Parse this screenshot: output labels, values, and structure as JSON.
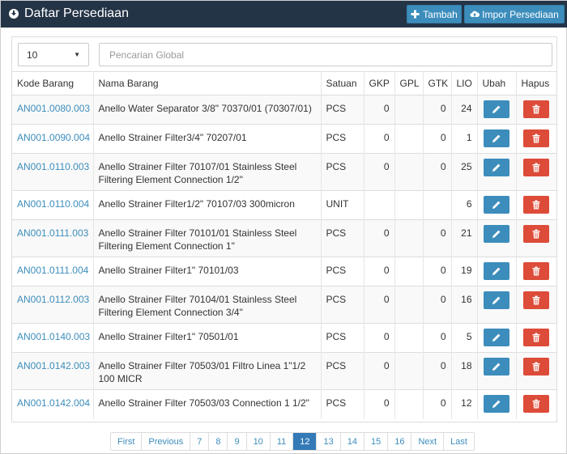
{
  "header": {
    "title": "Daftar Persediaan",
    "tambah_label": "Tambah",
    "impor_label": "Impor Persediaan"
  },
  "controls": {
    "page_size": "10",
    "search_placeholder": "Pencarian Global"
  },
  "table": {
    "columns": [
      "Kode Barang",
      "Nama Barang",
      "Satuan",
      "GKP",
      "GPL",
      "GTK",
      "LIO",
      "Ubah",
      "Hapus"
    ],
    "rows": [
      {
        "kode": "AN001.0080.003",
        "nama": "Anello Water Separator 3/8\" 70370/01 (70307/01)",
        "satuan": "PCS",
        "gkp": "0",
        "gpl": "",
        "gtk": "0",
        "lio": "24"
      },
      {
        "kode": "AN001.0090.004",
        "nama": "Anello Strainer Filter3/4\" 70207/01",
        "satuan": "PCS",
        "gkp": "0",
        "gpl": "",
        "gtk": "0",
        "lio": "1"
      },
      {
        "kode": "AN001.0110.003",
        "nama": "Anello Strainer Filter 70107/01 Stainless Steel Filtering Element Connection 1/2\"",
        "satuan": "PCS",
        "gkp": "0",
        "gpl": "",
        "gtk": "0",
        "lio": "25"
      },
      {
        "kode": "AN001.0110.004",
        "nama": "Anello Strainer Filter1/2\" 70107/03 300micron",
        "satuan": "UNIT",
        "gkp": "",
        "gpl": "",
        "gtk": "",
        "lio": "6"
      },
      {
        "kode": "AN001.0111.003",
        "nama": "Anello Strainer Filter 70101/01 Stainless Steel Filtering Element Connection 1\"",
        "satuan": "PCS",
        "gkp": "0",
        "gpl": "",
        "gtk": "0",
        "lio": "21"
      },
      {
        "kode": "AN001.0111.004",
        "nama": "Anello Strainer Filter1\" 70101/03",
        "satuan": "PCS",
        "gkp": "0",
        "gpl": "",
        "gtk": "0",
        "lio": "19"
      },
      {
        "kode": "AN001.0112.003",
        "nama": "Anello Strainer Filter 70104/01 Stainless Steel Filtering Element Connection 3/4\"",
        "satuan": "PCS",
        "gkp": "0",
        "gpl": "",
        "gtk": "0",
        "lio": "16"
      },
      {
        "kode": "AN001.0140.003",
        "nama": "Anello Strainer Filter1\" 70501/01",
        "satuan": "PCS",
        "gkp": "0",
        "gpl": "",
        "gtk": "0",
        "lio": "5"
      },
      {
        "kode": "AN001.0142.003",
        "nama": "Anello Strainer Filter 70503/01 Filtro Linea 1\"1/2 100 MICR",
        "satuan": "PCS",
        "gkp": "0",
        "gpl": "",
        "gtk": "0",
        "lio": "18"
      },
      {
        "kode": "AN001.0142.004",
        "nama": "Anello Strainer Filter 70503/03 Connection 1 1/2\"",
        "satuan": "PCS",
        "gkp": "0",
        "gpl": "",
        "gtk": "0",
        "lio": "12"
      }
    ]
  },
  "pagination": {
    "items": [
      "First",
      "Previous",
      "7",
      "8",
      "9",
      "10",
      "11",
      "12",
      "13",
      "14",
      "15",
      "16",
      "Next",
      "Last"
    ],
    "active": "12"
  },
  "icons": {
    "title": "download-icon",
    "tambah": "plus-icon",
    "impor": "cloud-upload-icon",
    "edit": "pencil-icon",
    "delete": "trash-icon"
  },
  "colors": {
    "topbar": "#243447",
    "primary": "#3c8dbc",
    "danger": "#dd4b39",
    "active_page": "#337ab7"
  }
}
